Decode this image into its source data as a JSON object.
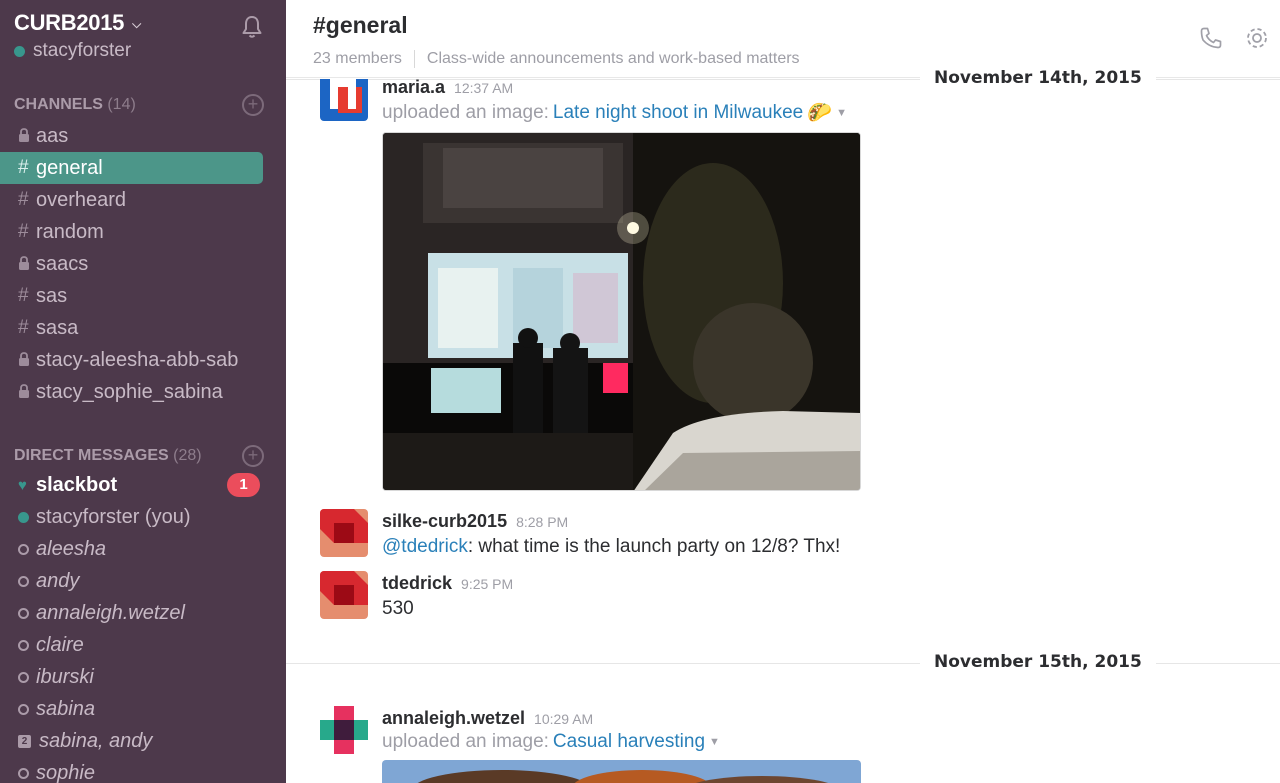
{
  "sidebar": {
    "team_name": "CURB2015",
    "user": "stacyforster",
    "channels_title": "CHANNELS",
    "channels_count": "(14)",
    "channels": [
      {
        "label": "aas",
        "private": true
      },
      {
        "label": "general",
        "private": false,
        "active": true
      },
      {
        "label": "overheard",
        "private": false
      },
      {
        "label": "random",
        "private": false
      },
      {
        "label": "saacs",
        "private": true
      },
      {
        "label": "sas",
        "private": false
      },
      {
        "label": "sasa",
        "private": false
      },
      {
        "label": "stacy-aleesha-abb-sab",
        "private": true
      },
      {
        "label": "stacy_sophie_sabina",
        "private": true
      }
    ],
    "dm_title": "DIRECT MESSAGES",
    "dm_count": "(28)",
    "dms": [
      {
        "label": "slackbot",
        "badge": "1"
      },
      {
        "label": "stacyforster (you)"
      },
      {
        "label": "aleesha"
      },
      {
        "label": "andy"
      },
      {
        "label": "annaleigh.wetzel"
      },
      {
        "label": "claire"
      },
      {
        "label": "iburski"
      },
      {
        "label": "sabina"
      },
      {
        "label": "sabina, andy",
        "group_count": "2"
      },
      {
        "label": "sophie"
      }
    ]
  },
  "channel": {
    "title": "#general",
    "members": "23 members",
    "purpose": "Class-wide announcements and work-based matters"
  },
  "messages": {
    "day1": "November 14th, 2015",
    "day2": "November 15th, 2015",
    "m1": {
      "author": "maria.a",
      "time": "12:37 AM",
      "upload_prefix": "uploaded an image:",
      "file": "Late night shoot in Milwaukee",
      "emoji": "🌮"
    },
    "m2": {
      "author": "silke-curb2015",
      "time": "8:28 PM",
      "mention": "@tdedrick",
      "text": ": what time is the launch party on 12/8? Thx!"
    },
    "m3": {
      "author": "tdedrick",
      "time": "9:25 PM",
      "text": "530"
    },
    "m4": {
      "author": "annaleigh.wetzel",
      "time": "10:29 AM",
      "upload_prefix": "uploaded an image:",
      "file": "Casual harvesting"
    }
  },
  "colors": {
    "sidebar_bg": "#4d394b",
    "active_channel": "#4c9689",
    "link": "#2a80b9",
    "badge": "#eb4d5c"
  }
}
